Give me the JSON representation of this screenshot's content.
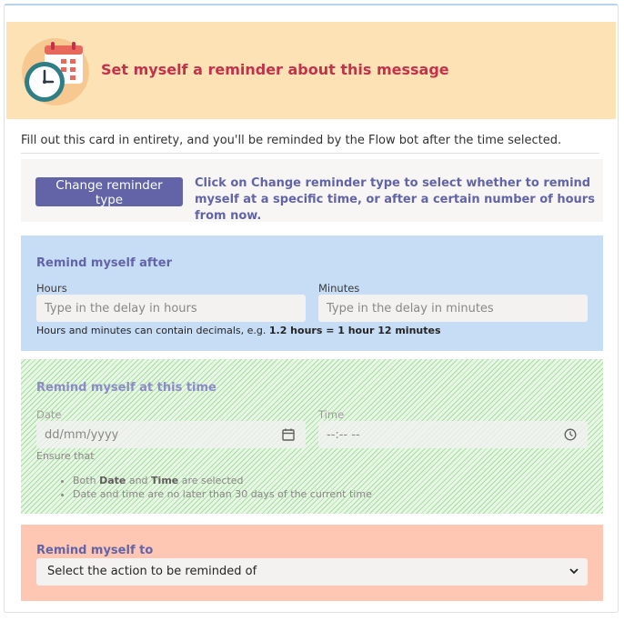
{
  "header": {
    "title": "Set myself a reminder about this message",
    "icon": "clock-calendar-icon",
    "background": "#fde2b6",
    "title_color": "#c4314b"
  },
  "intro": {
    "text": "Fill out this card in entirety, and you'll be reminded by the Flow bot after the time selected."
  },
  "reminder_type": {
    "button_label": "Change reminder type",
    "description": "Click on Change reminder type to select whether to remind myself at a specific time, or after a certain number of hours from now.",
    "accent": "#6264a7"
  },
  "remind_after": {
    "title": "Remind myself after",
    "hours_label": "Hours",
    "hours_placeholder": "Type in the delay in hours",
    "minutes_label": "Minutes",
    "minutes_placeholder": "Type in the delay in minutes",
    "hint_prefix": "Hours and minutes can contain decimals, e.g.",
    "hint_example": "1.2 hours = 1 hour 12 minutes",
    "background": "#c7dcf5"
  },
  "remind_at": {
    "title": "Remind myself at this time",
    "date_label": "Date",
    "date_placeholder": "dd/mm/yyyy",
    "time_label": "Time",
    "time_placeholder": "--:-- --",
    "ensure_label": "Ensure that",
    "rule1_prefix": "Both",
    "rule1_date": "Date",
    "rule1_and": "and",
    "rule1_time": "Time",
    "rule1_suffix": "are selected",
    "rule2": "Date and time are no later than 30 days of the current time",
    "state": "disabled"
  },
  "remind_to": {
    "title": "Remind myself to",
    "select_value": "Select the action to be reminded of",
    "background": "#fec7b4"
  }
}
